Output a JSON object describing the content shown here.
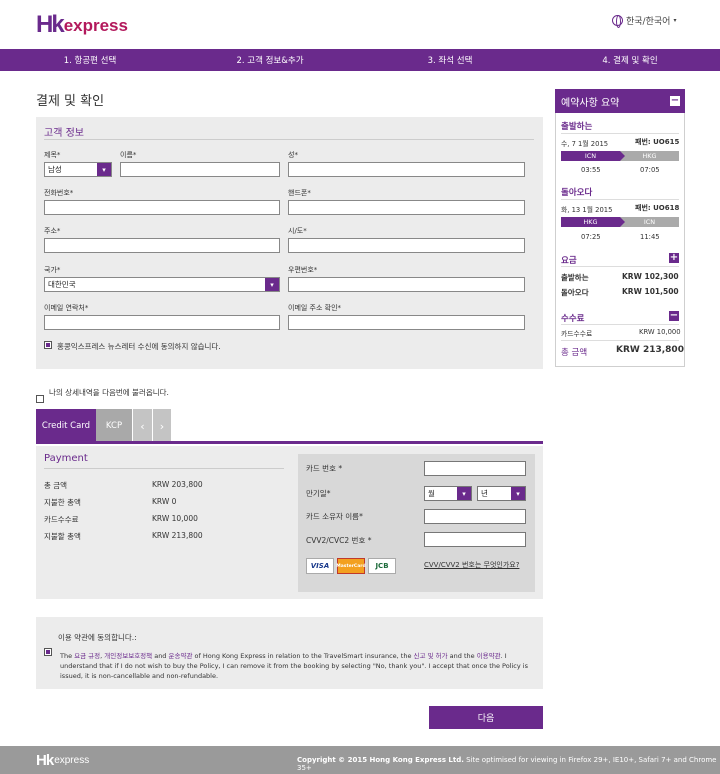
{
  "header": {
    "logo_mark": "Hk",
    "logo_text": "express",
    "language": "한국/한국어"
  },
  "steps": [
    "1. 항공편 선택",
    "2. 고객 정보&추가",
    "3. 좌석 선택",
    "4. 결제 및 확인"
  ],
  "page_title": "결제 및 확인",
  "customer": {
    "title": "고객 정보",
    "title_label": "제목*",
    "title_value": "남성",
    "first_name_label": "이름*",
    "last_name_label": "성*",
    "phone_label": "전화번호*",
    "mobile_label": "핸드폰*",
    "address_label": "주소*",
    "city_label": "시/도*",
    "country_label": "국가*",
    "country_value": "대한민국",
    "postcode_label": "우편번호*",
    "email_label": "이메일 연락처*",
    "email_confirm_label": "이메일 주소 확인*",
    "newsletter_label": "홍콩익스프레스 뉴스레터 수신에 동의하지 않습니다."
  },
  "save_details_label": "나의 상세내역을 다음번에 불러옵니다.",
  "tabs": {
    "credit": "Credit Card",
    "kcp": "KCP",
    "prev": "‹",
    "next": "›"
  },
  "payment": {
    "title": "Payment",
    "rows": [
      {
        "label": "총 금액",
        "value": "KRW 203,800"
      },
      {
        "label": "지불한 총액",
        "value": "KRW 0"
      },
      {
        "label": "카드수수료",
        "value": "KRW 10,000"
      },
      {
        "label": "지불할 총액",
        "value": "KRW 213,800"
      }
    ],
    "card_number_label": "카드 번호 *",
    "expiry_label": "만기일*",
    "month_value": "월",
    "year_value": "년",
    "holder_label": "카드 소유자 이름*",
    "cvv_label": "CVV2/CVC2 번호 *",
    "cvv_link": "CVV/CVV2 번호는 무엇인가요?",
    "logos": [
      "VISA",
      "MasterCard",
      "JCB"
    ]
  },
  "terms": {
    "agree_label": "이용 약관에 동의합니다.:",
    "p1": "The ",
    "l1": "요금 규정",
    "s1": ", ",
    "l2": "개인정보보호정책",
    "p2": " and ",
    "l3": "운송약관",
    "p3": " of Hong Kong Express in relation to the TravelSmart insurance, the ",
    "l4": "신고 및 허가",
    "p4": " and the ",
    "l5": "이용약관",
    "p5": ". I understand that if I do not wish to buy the Policy, I can remove it from the booking by selecting \"No, thank you\". I accept that once the Policy is issued, it is non-cancellable and non-refundable."
  },
  "next_button": "다음",
  "summary": {
    "title": "예약사항 요약",
    "outbound": {
      "label": "출발하는",
      "date": "수, 7 1월 2015",
      "flight_prefix": "패번:",
      "flight": "UO615",
      "from": "ICN",
      "to": "HKG",
      "dep": "03:55",
      "arr": "07:05"
    },
    "inbound": {
      "label": "돌아오다",
      "date": "화, 13 1월 2015",
      "flight_prefix": "패번:",
      "flight": "UO618",
      "from": "HKG",
      "to": "ICN",
      "dep": "07:25",
      "arr": "11:45"
    },
    "fare_label": "요금",
    "fare_out_label": "출발하는",
    "fare_out_value": "KRW 102,300",
    "fare_in_label": "돌아오다",
    "fare_in_value": "KRW 101,500",
    "fees_label": "수수료",
    "card_fee_label": "카드수수료",
    "card_fee_value": "KRW 10,000",
    "total_label": "총 금액",
    "total_value": "KRW 213,800"
  },
  "footer": {
    "logo_mark": "Hk",
    "logo_text": "express",
    "copyright": "Copyright © 2015 Hong Kong Express Ltd.",
    "note": " Site optimised for viewing in Firefox 29+, IE10+, Safari 7+ and Chrome 35+"
  },
  "colors": {
    "brand": "#6a2a8c",
    "logo_accent": "#b3195c",
    "footer": "#9a9a9a"
  }
}
